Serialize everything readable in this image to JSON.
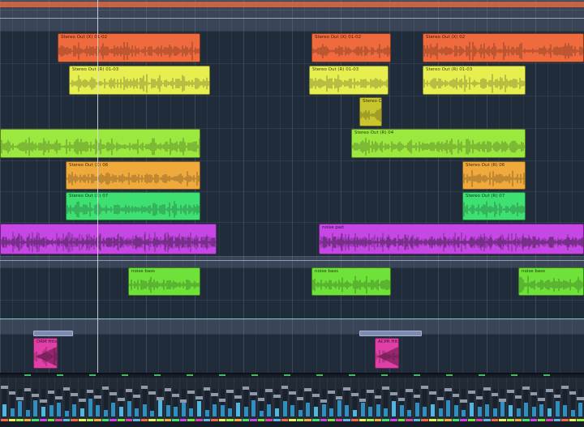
{
  "colors": {
    "lane_bg": "#212c3b",
    "folder_bg": "#3a4557",
    "orange": "#ef6a3c",
    "yellow": "#e7ee4f",
    "olive": "#c9c52e",
    "green": "#9be83f",
    "amber": "#f0a93b",
    "brightgreen": "#3fe072",
    "magenta": "#c646e6",
    "lime": "#6fe23a",
    "pink": "#e13fa8"
  },
  "tracks": [
    {
      "id": "t1",
      "color": "orange",
      "clips": [
        {
          "label": "Stereo Out (X) 01-02"
        },
        {
          "label": "Stereo Out (X) 01-02"
        },
        {
          "label": "Stereo Out (X) 02"
        }
      ]
    },
    {
      "id": "t2",
      "color": "yellow",
      "clips": [
        {
          "label": "Stereo Out (R) 01-03"
        },
        {
          "label": "Stereo Out (R) 01-03"
        },
        {
          "label": "Stereo Out (R) 01-03"
        }
      ]
    },
    {
      "id": "t3",
      "color": "olive",
      "clips": [
        {
          "label": "Stereo Out"
        }
      ]
    },
    {
      "id": "t4",
      "color": "green",
      "clips": [
        {
          "label": ""
        },
        {
          "label": "Stereo Out (R) 04"
        }
      ]
    },
    {
      "id": "t5",
      "color": "amber",
      "clips": [
        {
          "label": "Stereo Out (X) 06"
        },
        {
          "label": "Stereo Out (R) 06"
        }
      ]
    },
    {
      "id": "t6",
      "color": "brightgreen",
      "clips": [
        {
          "label": "Stereo Out (X) 07"
        },
        {
          "label": "Stereo Out (R) 07"
        }
      ]
    },
    {
      "id": "t7",
      "color": "magenta",
      "clips": [
        {
          "label": ""
        },
        {
          "label": "noise pad"
        }
      ]
    },
    {
      "id": "t8",
      "color": "lime",
      "clips": [
        {
          "label": "noise bass"
        },
        {
          "label": "noise bass"
        },
        {
          "label": "noise bass"
        }
      ]
    },
    {
      "id": "t9",
      "color": "pink",
      "clips": [
        {
          "label": "DRM Hits St"
        },
        {
          "label": "ACPR Hits St"
        }
      ]
    }
  ],
  "mixer": {
    "levels": [
      0.45,
      0.3,
      0.55,
      0.25,
      0.6,
      0.35,
      0.4,
      0.5,
      0.2,
      0.45,
      0.3,
      0.65,
      0.4,
      0.25,
      0.5,
      0.35,
      0.55,
      0.3,
      0.45,
      0.2,
      0.6,
      0.4,
      0.35,
      0.5,
      0.3,
      0.55,
      0.25,
      0.45,
      0.4,
      0.3,
      0.5,
      0.35,
      0.6,
      0.2,
      0.45,
      0.3,
      0.55,
      0.4,
      0.25,
      0.5,
      0.35,
      0.45,
      0.3,
      0.6,
      0.4,
      0.25,
      0.5,
      0.35,
      0.45,
      0.3,
      0.55,
      0.4,
      0.25,
      0.5,
      0.35,
      0.45,
      0.3,
      0.6,
      0.4,
      0.25,
      0.5,
      0.35,
      0.45,
      0.3,
      0.55,
      0.4,
      0.3,
      0.5,
      0.35,
      0.45,
      0.3,
      0.55,
      0.4,
      0.25,
      0.5
    ],
    "cap_colors": [
      "#ef6a3c",
      "#e7ee4f",
      "#9be83f",
      "#f0a93b",
      "#3fe072",
      "#c646e6",
      "#6fe23a",
      "#e13fa8",
      "#5bb7e8"
    ]
  }
}
